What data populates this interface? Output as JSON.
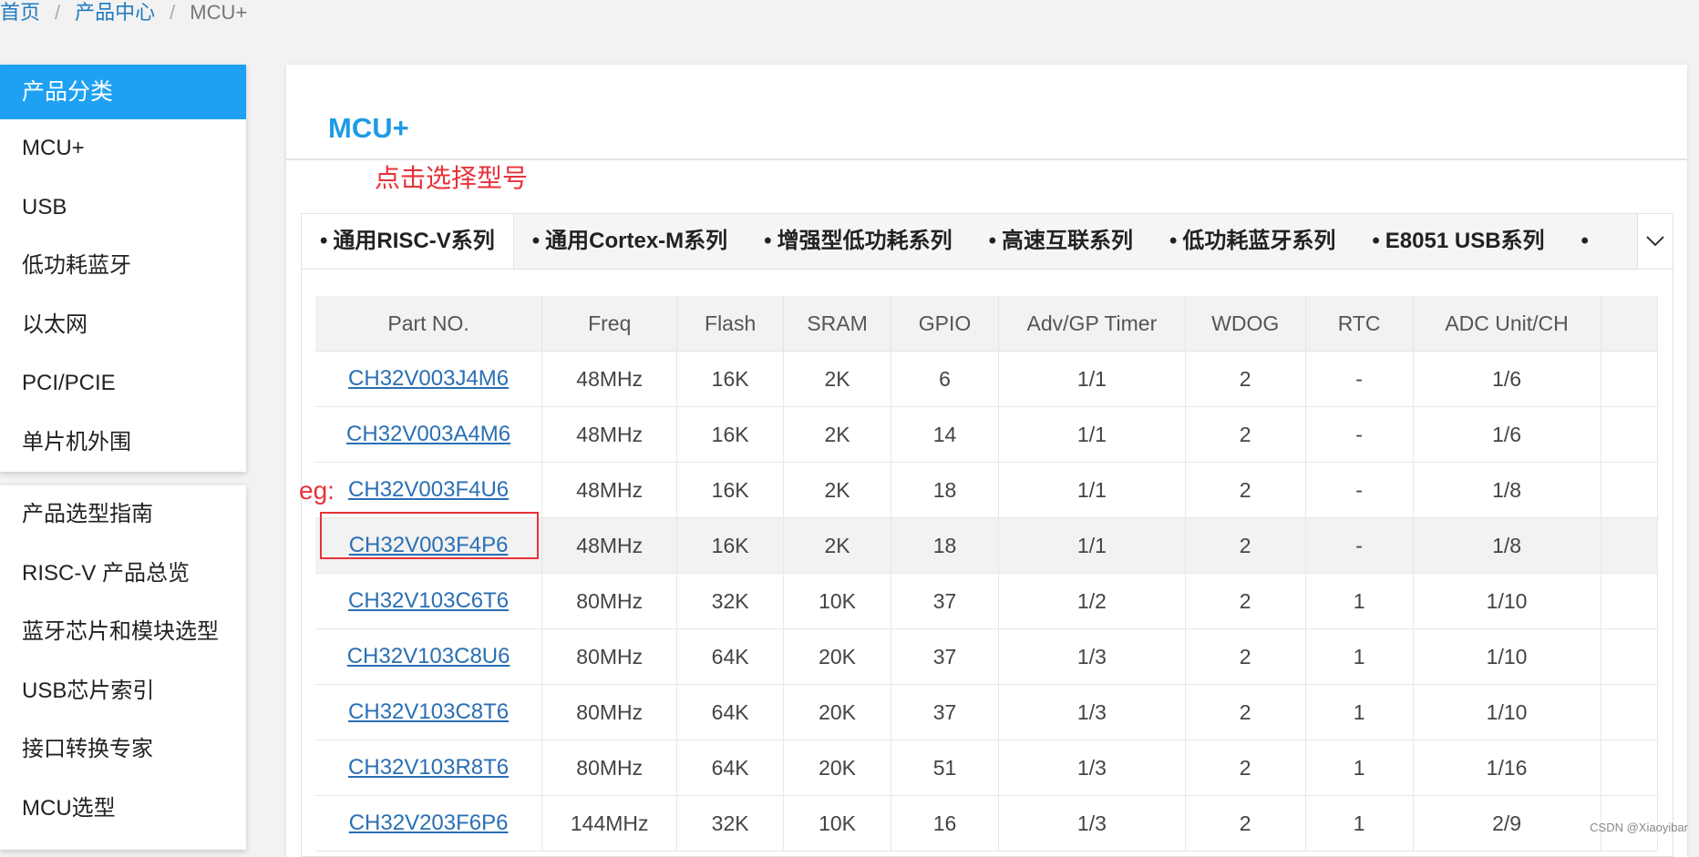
{
  "breadcrumb": {
    "home": "首页",
    "products": "产品中心",
    "current": "MCU+",
    "separator": "/"
  },
  "sidebar": {
    "header": "产品分类",
    "categories": [
      "MCU+",
      "USB",
      "低功耗蓝牙",
      "以太网",
      "PCI/PCIE",
      "单片机外围"
    ],
    "guides": [
      "产品选型指南",
      "RISC-V 产品总览",
      "蓝牙芯片和模块选型",
      "USB芯片索引",
      "接口转换专家",
      "MCU选型"
    ]
  },
  "main": {
    "title": "MCU+",
    "annotation": "点击选择型号",
    "tabs": [
      "通用RISC-V系列",
      "通用Cortex-M系列",
      "增强型低功耗系列",
      "高速互联系列",
      "低功耗蓝牙系列",
      "E8051 USB系列"
    ],
    "tab_bullet": "•",
    "more_icon": "chevron-down-icon"
  },
  "table": {
    "headers": [
      "Part NO.",
      "Freq",
      "Flash",
      "SRAM",
      "GPIO",
      "Adv/GP Timer",
      "WDOG",
      "RTC",
      "ADC Unit/CH",
      ""
    ],
    "rows": [
      [
        "CH32V003J4M6",
        "48MHz",
        "16K",
        "2K",
        "6",
        "1/1",
        "2",
        "-",
        "1/6",
        ""
      ],
      [
        "CH32V003A4M6",
        "48MHz",
        "16K",
        "2K",
        "14",
        "1/1",
        "2",
        "-",
        "1/6",
        ""
      ],
      [
        "CH32V003F4U6",
        "48MHz",
        "16K",
        "2K",
        "18",
        "1/1",
        "2",
        "-",
        "1/8",
        ""
      ],
      [
        "CH32V003F4P6",
        "48MHz",
        "16K",
        "2K",
        "18",
        "1/1",
        "2",
        "-",
        "1/8",
        ""
      ],
      [
        "CH32V103C6T6",
        "80MHz",
        "32K",
        "10K",
        "37",
        "1/2",
        "2",
        "1",
        "1/10",
        ""
      ],
      [
        "CH32V103C8U6",
        "80MHz",
        "64K",
        "20K",
        "37",
        "1/3",
        "2",
        "1",
        "1/10",
        ""
      ],
      [
        "CH32V103C8T6",
        "80MHz",
        "64K",
        "20K",
        "37",
        "1/3",
        "2",
        "1",
        "1/10",
        ""
      ],
      [
        "CH32V103R8T6",
        "80MHz",
        "64K",
        "20K",
        "51",
        "1/3",
        "2",
        "1",
        "1/16",
        ""
      ],
      [
        "CH32V203F6P6",
        "144MHz",
        "32K",
        "10K",
        "16",
        "1/3",
        "2",
        "1",
        "2/9",
        ""
      ]
    ]
  },
  "annotations": {
    "eg_label": "eg:"
  },
  "watermark": "CSDN @Xiaoyibar",
  "colors": {
    "accent": "#1ea1f2",
    "title": "#1e9be6",
    "link": "#2a6fb4",
    "annotation": "#e8323a"
  }
}
